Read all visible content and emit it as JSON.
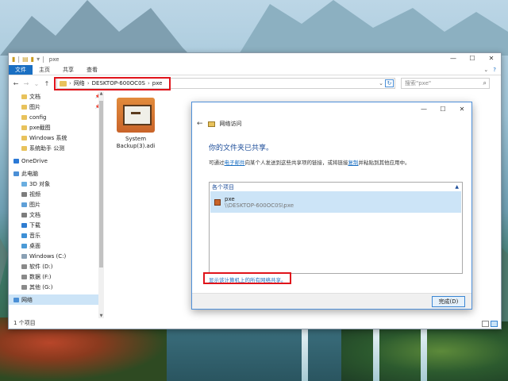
{
  "explorer": {
    "title": "pxe",
    "ribbon_tabs": [
      "文件",
      "主页",
      "共享",
      "查看"
    ],
    "address": {
      "crumbs": [
        "网络",
        "DESKTOP-600OC0S",
        "pxe"
      ]
    },
    "search_placeholder": "搜索\"pxe\"",
    "sidebar": [
      {
        "label": "文档",
        "pinned": true,
        "color": "#e8c25c"
      },
      {
        "label": "图片",
        "pinned": true,
        "color": "#e8c25c"
      },
      {
        "label": "config",
        "pinned": false,
        "color": "#e8c25c"
      },
      {
        "label": "pxe截图",
        "pinned": false,
        "color": "#e8c25c"
      },
      {
        "label": "Windows 系统",
        "pinned": false,
        "color": "#e8c25c"
      },
      {
        "label": "系统助手 公测",
        "pinned": false,
        "color": "#e8c25c"
      },
      {
        "label": "OneDrive",
        "pinned": false,
        "color": "#2b79d6"
      },
      {
        "label": "此电脑",
        "pinned": false,
        "color": "#4b8fd6"
      },
      {
        "label": "3D 对象",
        "pinned": false,
        "color": "#6aaee0"
      },
      {
        "label": "视频",
        "pinned": false,
        "color": "#7d7d7d"
      },
      {
        "label": "图片",
        "pinned": false,
        "color": "#5fa0d8"
      },
      {
        "label": "文档",
        "pinned": false,
        "color": "#7d7d7d"
      },
      {
        "label": "下载",
        "pinned": false,
        "color": "#2f7dd1"
      },
      {
        "label": "音乐",
        "pinned": false,
        "color": "#3d8fd6"
      },
      {
        "label": "桌面",
        "pinned": false,
        "color": "#4b9ad6"
      },
      {
        "label": "Windows (C:)",
        "pinned": false,
        "color": "#8aa0b4"
      },
      {
        "label": "软件 (D:)",
        "pinned": false,
        "color": "#8a8a8a"
      },
      {
        "label": "数据 (F:)",
        "pinned": false,
        "color": "#8a8a8a"
      },
      {
        "label": "其他 (G:)",
        "pinned": false,
        "color": "#8a8a8a"
      },
      {
        "label": "网络",
        "pinned": false,
        "color": "#4b8fd6"
      }
    ],
    "file": {
      "name_line1": "System",
      "name_line2": "Backup(3).adi"
    },
    "status": "1 个项目"
  },
  "dialog": {
    "header": "网络访问",
    "title": "你的文件夹已共享。",
    "desc_pre": "可通过",
    "desc_link1": "电子邮件",
    "desc_mid": "向某个人发送到这些共享项的链接，或将链接",
    "desc_link2": "复制",
    "desc_post": "并粘贴到其他应用中。",
    "list_header": "各个项目",
    "item_name": "pxe",
    "item_path": "\\\\DESKTOP-600OC0S\\pxe",
    "show_all_link": "显示该计算机上的所有网络共享。",
    "done_button": "完成(D)"
  }
}
